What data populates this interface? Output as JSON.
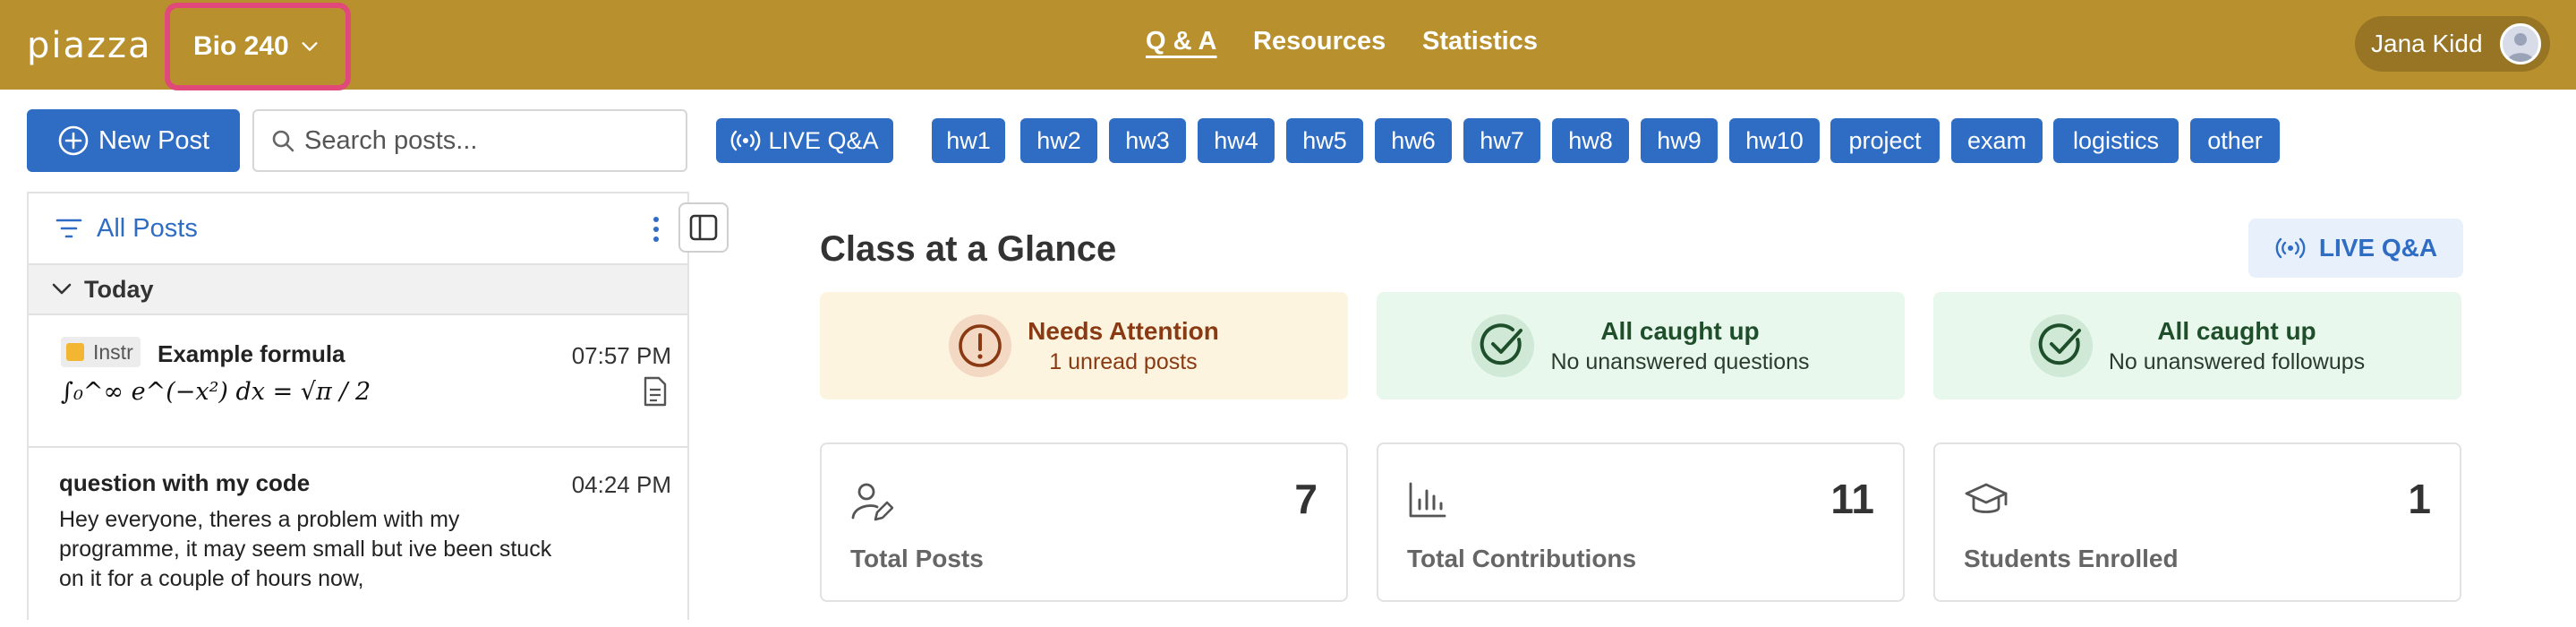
{
  "topbar": {
    "logo": "piazza",
    "course": "Bio 240",
    "nav": [
      "Q & A",
      "Resources",
      "Statistics"
    ],
    "active_nav": "Q & A",
    "user_name": "Jana Kidd"
  },
  "toolbar": {
    "new_post_label": "New Post",
    "search_placeholder": "Search posts...",
    "live_label": "LIVE Q&A",
    "tags": [
      "hw1",
      "hw2",
      "hw3",
      "hw4",
      "hw5",
      "hw6",
      "hw7",
      "hw8",
      "hw9",
      "hw10",
      "project",
      "exam",
      "logistics",
      "other"
    ]
  },
  "feed": {
    "filter_label": "All Posts",
    "group_label": "Today",
    "posts": [
      {
        "badge": "Instr",
        "title": "Example formula",
        "time": "07:57 PM",
        "formula": "∫₀^∞ e^(−x²) dx = √π / 2"
      },
      {
        "title": "question with my code",
        "time": "04:24 PM",
        "body": "Hey everyone, theres a problem with my programme, it may seem small but ive been stuck on it for a couple of hours now,"
      }
    ]
  },
  "glance": {
    "title": "Class at a Glance",
    "live_button": "LIVE Q&A",
    "status": [
      {
        "title": "Needs Attention",
        "subtitle": "1 unread posts"
      },
      {
        "title": "All caught up",
        "subtitle": "No unanswered questions"
      },
      {
        "title": "All caught up",
        "subtitle": "No unanswered followups"
      }
    ],
    "stats": [
      {
        "label": "Total Posts",
        "value": "7"
      },
      {
        "label": "Total Contributions",
        "value": "11"
      },
      {
        "label": "Students Enrolled",
        "value": "1"
      }
    ]
  },
  "colors": {
    "topbar": "#b8902e",
    "primary": "#2f6dc4",
    "highlight_border": "#e0497a"
  }
}
